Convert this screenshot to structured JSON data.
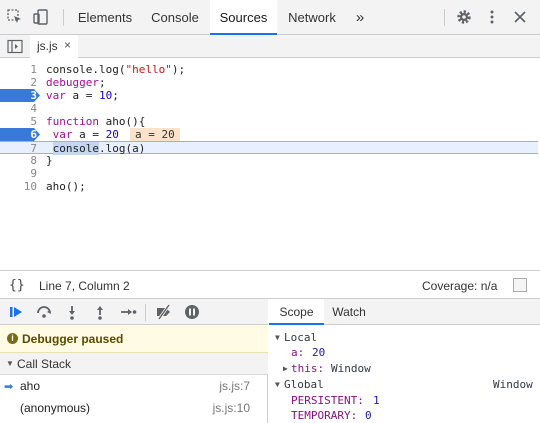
{
  "topbar": {
    "tabs": [
      {
        "label": "Elements"
      },
      {
        "label": "Console"
      },
      {
        "label": "Sources"
      },
      {
        "label": "Network"
      }
    ],
    "more_label": "»",
    "icons": [
      "inspect-element-icon",
      "device-toolbar-icon",
      "settings-icon",
      "more-menu-icon",
      "close-icon"
    ]
  },
  "filebar": {
    "file_name": "js.js",
    "close_glyph": "×"
  },
  "editor": {
    "lines": [
      {
        "n": "1",
        "text": "console.log(\"hello\");"
      },
      {
        "n": "2",
        "text": "debugger;"
      },
      {
        "n": "3",
        "text": "var a = 10;"
      },
      {
        "n": "4",
        "text": ""
      },
      {
        "n": "5",
        "text": "function aho(){"
      },
      {
        "n": "6",
        "text": " var a = 20"
      },
      {
        "n": "7",
        "text": " console.log(a)"
      },
      {
        "n": "8",
        "text": "}"
      },
      {
        "n": "9",
        "text": ""
      },
      {
        "n": "10",
        "text": "aho();"
      }
    ],
    "breakpoint_lines": [
      "3",
      "6"
    ],
    "current_line": "7",
    "inline_value": "a = 20"
  },
  "status": {
    "braces": "{}",
    "position": "Line 7, Column 2",
    "coverage": "Coverage: n/a"
  },
  "debugger": {
    "paused_label": "Debugger paused",
    "call_stack_label": "Call Stack",
    "frames": [
      {
        "name": "aho",
        "location": "js.js:7"
      },
      {
        "name": "(anonymous)",
        "location": "js.js:10"
      }
    ]
  },
  "scope": {
    "tabs": [
      {
        "label": "Scope"
      },
      {
        "label": "Watch"
      }
    ],
    "local_label": "Local",
    "local_a_key": "a:",
    "local_a_val": "20",
    "local_this_key": "this:",
    "local_this_val": "Window",
    "global_label": "Global",
    "global_val": "Window",
    "global_items": [
      {
        "key": "PERSISTENT:",
        "val": "1"
      },
      {
        "key": "TEMPORARY:",
        "val": "0"
      }
    ]
  },
  "colors": {
    "accent": "#1a73e8",
    "breakpoint": "#3879d9",
    "paused_bg": "#fffbe5",
    "exec_line": "#e8f0ff"
  }
}
